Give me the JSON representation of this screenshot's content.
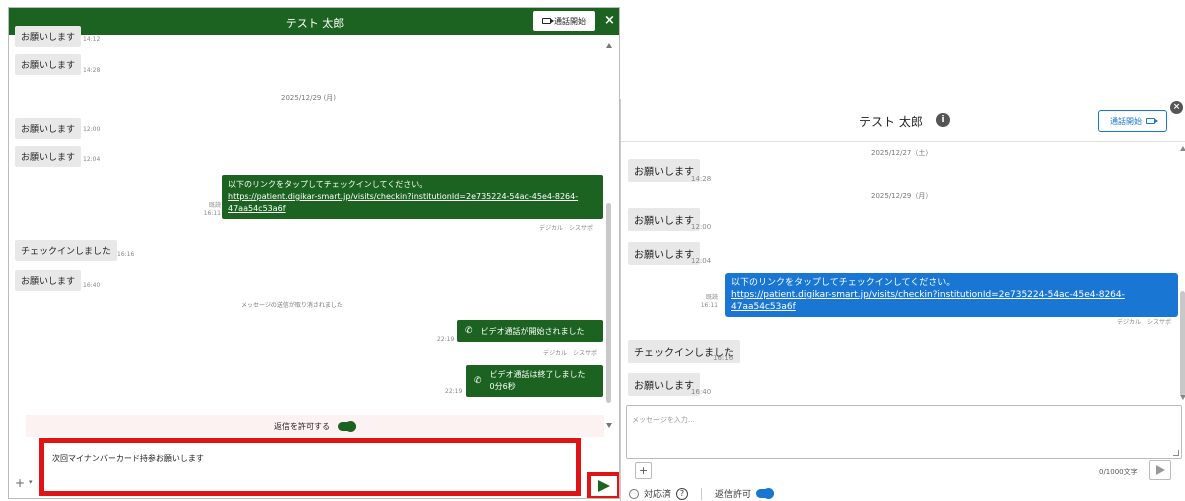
{
  "left_panel": {
    "title": "テスト 太郎",
    "call_button_label": "通話開始",
    "close_label": "×",
    "messages": [
      {
        "text": "お願いします",
        "time": "14:12"
      },
      {
        "text": "お願いします",
        "time": "14:28"
      },
      {
        "text": "お願いします",
        "time": "12:00"
      },
      {
        "text": "お願いします",
        "time": "12:04"
      },
      {
        "text": "チェックインしました",
        "time": "16:16"
      },
      {
        "text": "お願いします",
        "time": "16:40"
      }
    ],
    "date_divider": "2025/12/29 (月)",
    "outgoing_link_message": {
      "text": "以下のリンクをタップしてチェックインしてください。",
      "link_line1": "https://patient.digikar-smart.jp/visits/checkin?institutionId=2e735224-54ac-45e4-8264-",
      "link_line2": "47aa54c53a6f",
      "read_status": "既読",
      "time": "16:11",
      "sender": "デジカル　シスサポ"
    },
    "revoked_notice": "メッセージの送信が取り消されました",
    "call_started": {
      "text": "ビデオ通話が開始されました",
      "time": "22:19",
      "sender": "デジカル　シスサポ"
    },
    "call_ended": {
      "text": "ビデオ通話は終了しました",
      "duration": "0分6秒",
      "time": "22:19"
    },
    "allow_reply_label": "返信を許可する",
    "input_text": "次回マイナンバーカード持参お願いします",
    "plus_label": "+",
    "plus_caret": "▾"
  },
  "right_panel": {
    "title": "テスト 太郎",
    "info_icon_glyph": "i",
    "call_button_label": "通話開始",
    "close_glyph": "×",
    "date_top": "2025/12/27（土）",
    "date_divider": "2025/12/29（月）",
    "messages": [
      {
        "text": "お願いします",
        "time": "14:28"
      },
      {
        "text": "お願いします",
        "time": "12:00"
      },
      {
        "text": "お願いします",
        "time": "12:04"
      },
      {
        "text": "チェックインしました",
        "time": "16:16"
      },
      {
        "text": "お願いします",
        "time": "16:40"
      }
    ],
    "outgoing_link_message": {
      "text": "以下のリンクをタップしてチェックインしてください。",
      "link": "https://patient.digikar-smart.jp/visits/checkin?institutionId=2e735224-54ac-45e4-8264-47aa54c53a6f",
      "read_status": "既読",
      "time": "16:11",
      "sender": "デジカル　シスサポ"
    },
    "input_placeholder": "メッセージを入力...",
    "plus_label": "+",
    "char_count": "0/1000文字",
    "responded_label": "対応済",
    "help_glyph": "?",
    "allow_reply_label": "返信許可"
  },
  "colors": {
    "left_accent": "#1c6321",
    "right_accent": "#1976d2",
    "highlight_red": "#e01414"
  }
}
